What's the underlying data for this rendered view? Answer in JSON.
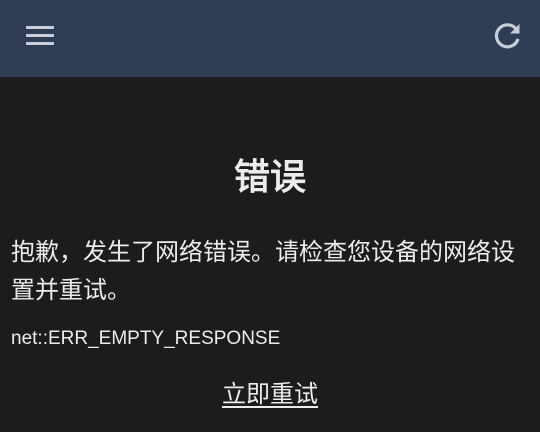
{
  "app_bar": {
    "background": "#2f3e55",
    "menu_icon": "hamburger-menu-icon",
    "refresh_icon": "refresh-icon"
  },
  "error": {
    "title": "错误",
    "message": "抱歉，发生了网络错误。请检查您设备的网络设置并重试。",
    "code": "net::ERR_EMPTY_RESPONSE",
    "retry_label": "立即重试"
  },
  "colors": {
    "page_background": "#1c1c1c",
    "text": "#ececec",
    "icon": "#c9cfd8"
  }
}
